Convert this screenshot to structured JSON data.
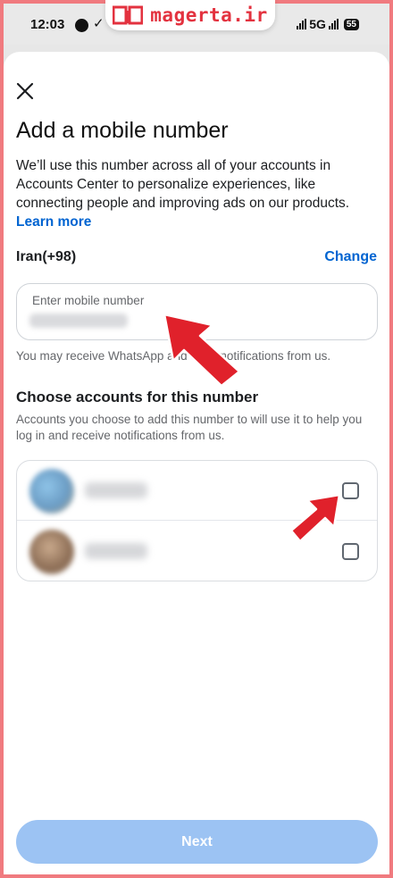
{
  "status_bar": {
    "time": "12:03",
    "network": "5G",
    "battery": "55"
  },
  "watermark": {
    "text": "magerta.ir",
    "color": "#e3323f"
  },
  "header": {
    "close_icon": "close-icon",
    "title": "Add a mobile number"
  },
  "intro": {
    "description": "We’ll use this number across all of your accounts in Accounts Center to personalize experiences, like connecting people and improving ads on our products.",
    "learn_more": "Learn more"
  },
  "country": {
    "value": "Iran(+98)",
    "change_label": "Change"
  },
  "phone_input": {
    "placeholder": "Enter mobile number",
    "note": "You may receive WhatsApp and SMS notifications from us."
  },
  "accounts_section": {
    "title": "Choose accounts for this number",
    "subtitle": "Accounts you choose to add this number to will use it to help you log in and receive notifications from us.",
    "accounts": [
      {
        "name": "",
        "checked": false
      },
      {
        "name": "",
        "checked": false
      }
    ]
  },
  "footer": {
    "next_label": "Next"
  },
  "colors": {
    "accent": "#0064d1",
    "button_disabled": "#9cc3f3",
    "annotation_arrow": "#e0212b",
    "frame_border": "#f07a7f"
  }
}
